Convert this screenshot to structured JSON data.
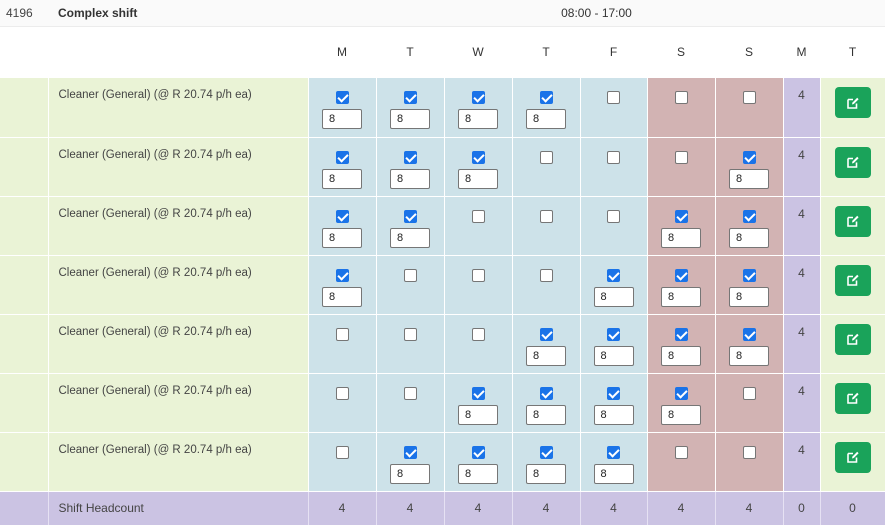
{
  "shift": {
    "id": "4196",
    "name": "Complex shift",
    "time": "08:00 - 17:00"
  },
  "columns": {
    "days": [
      "M",
      "T",
      "W",
      "T",
      "F",
      "S",
      "S"
    ],
    "count_header": "M",
    "action_header": "T"
  },
  "rows": [
    {
      "role": "Cleaner (General) (@ R  20.74 p/h ea)",
      "days": [
        true,
        true,
        true,
        true,
        false,
        false,
        false
      ],
      "hours": [
        "8",
        "8",
        "8",
        "8",
        "",
        "",
        ""
      ],
      "count": "4"
    },
    {
      "role": "Cleaner (General) (@ R  20.74 p/h ea)",
      "days": [
        true,
        true,
        true,
        false,
        false,
        false,
        true
      ],
      "hours": [
        "8",
        "8",
        "8",
        "",
        "",
        "",
        "8"
      ],
      "count": "4"
    },
    {
      "role": "Cleaner (General) (@ R  20.74 p/h ea)",
      "days": [
        true,
        true,
        false,
        false,
        false,
        true,
        true
      ],
      "hours": [
        "8",
        "8",
        "",
        "",
        "",
        "8",
        "8"
      ],
      "count": "4"
    },
    {
      "role": "Cleaner (General) (@ R  20.74 p/h ea)",
      "days": [
        true,
        false,
        false,
        false,
        true,
        true,
        true
      ],
      "hours": [
        "8",
        "",
        "",
        "",
        "8",
        "8",
        "8"
      ],
      "count": "4"
    },
    {
      "role": "Cleaner (General) (@ R  20.74 p/h ea)",
      "days": [
        false,
        false,
        false,
        true,
        true,
        true,
        true
      ],
      "hours": [
        "",
        "",
        "",
        "8",
        "8",
        "8",
        "8"
      ],
      "count": "4"
    },
    {
      "role": "Cleaner (General) (@ R  20.74 p/h ea)",
      "days": [
        false,
        false,
        true,
        true,
        true,
        true,
        false
      ],
      "hours": [
        "",
        "",
        "8",
        "8",
        "8",
        "8",
        ""
      ],
      "count": "4"
    },
    {
      "role": "Cleaner (General) (@ R  20.74 p/h ea)",
      "days": [
        false,
        true,
        true,
        true,
        true,
        false,
        false
      ],
      "hours": [
        "",
        "8",
        "8",
        "8",
        "8",
        "",
        ""
      ],
      "count": "4"
    }
  ],
  "footer": {
    "label": "Shift Headcount",
    "day_totals": [
      "4",
      "4",
      "4",
      "4",
      "4",
      "4",
      "4"
    ],
    "count_total": "0",
    "action_total": "0"
  },
  "icons": {
    "edit": "edit-icon"
  },
  "colors": {
    "weekday_bg": "#cde2e9",
    "weekend_bg": "#d2b3b3",
    "count_bg": "#cbc3e3",
    "role_bg": "#eaf3d6",
    "edit_button": "#1aa35a",
    "checkbox_checked": "#1a73e8"
  }
}
